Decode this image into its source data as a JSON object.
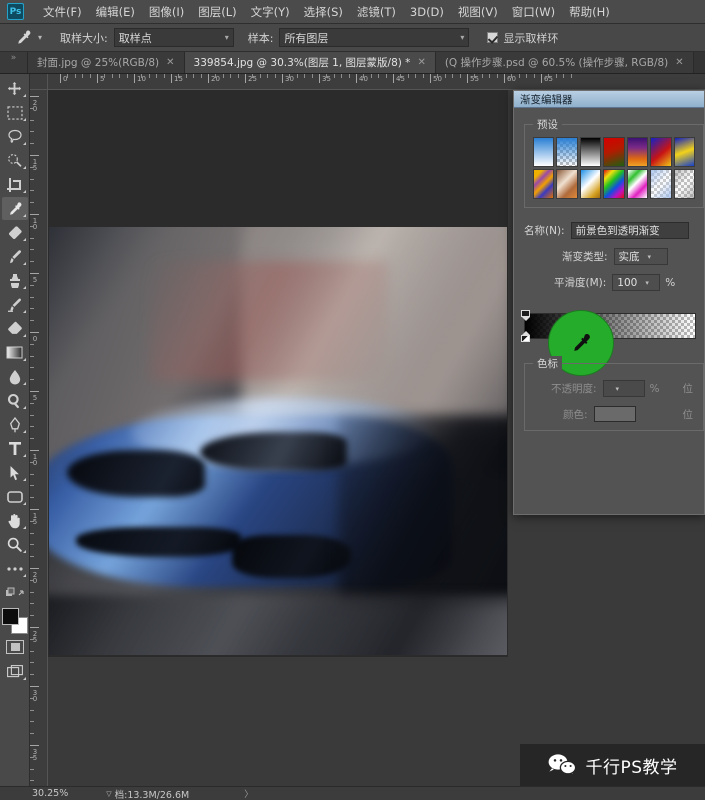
{
  "app": {
    "logo": "Ps",
    "menus": [
      {
        "label": "文件(F)"
      },
      {
        "label": "编辑(E)"
      },
      {
        "label": "图像(I)"
      },
      {
        "label": "图层(L)"
      },
      {
        "label": "文字(Y)"
      },
      {
        "label": "选择(S)"
      },
      {
        "label": "滤镜(T)"
      },
      {
        "label": "3D(D)"
      },
      {
        "label": "视图(V)"
      },
      {
        "label": "窗口(W)"
      },
      {
        "label": "帮助(H)"
      }
    ]
  },
  "options_bar": {
    "tool_icon": "eyedropper-icon",
    "sample_size_label": "取样大小:",
    "sample_size_value": "取样点",
    "sample_label": "样本:",
    "sample_value": "所有图层",
    "show_ring_label": "显示取样环",
    "show_ring_checked": true
  },
  "tabs": {
    "grip": "»",
    "items": [
      {
        "label": "封面.jpg @ 25%(RGB/8)",
        "close": "✕",
        "active": false
      },
      {
        "label": "339854.jpg @ 30.3%(图层 1, 图层蒙版/8) *",
        "close": "✕",
        "active": true
      },
      {
        "label": "(Q 操作步骤.psd @ 60.5% (操作步骤, RGB/8)",
        "close": "✕",
        "active": false
      }
    ]
  },
  "toolbar": {
    "tools": [
      {
        "name": "move-tool",
        "icon": "move-icon",
        "active": false
      },
      {
        "name": "marquee-tool",
        "icon": "rectangular-marquee-icon",
        "active": false
      },
      {
        "name": "lasso-tool",
        "icon": "lasso-icon",
        "active": false
      },
      {
        "name": "quick-selection-tool",
        "icon": "magic-wand-icon",
        "active": false
      },
      {
        "name": "crop-tool",
        "icon": "crop-icon",
        "active": false
      },
      {
        "name": "eyedropper-tool",
        "icon": "eyedropper-icon",
        "active": true
      },
      {
        "name": "healing-brush-tool",
        "icon": "spot-healing-icon",
        "active": false
      },
      {
        "name": "brush-tool",
        "icon": "brush-icon",
        "active": false
      },
      {
        "name": "clone-stamp-tool",
        "icon": "clone-stamp-icon",
        "active": false
      },
      {
        "name": "history-brush-tool",
        "icon": "history-brush-icon",
        "active": false
      },
      {
        "name": "eraser-tool",
        "icon": "eraser-icon",
        "active": false
      },
      {
        "name": "gradient-tool",
        "icon": "gradient-icon",
        "active": false
      },
      {
        "name": "blur-tool",
        "icon": "blur-drop-icon",
        "active": false
      },
      {
        "name": "dodge-tool",
        "icon": "dodge-icon",
        "active": false
      },
      {
        "name": "pen-tool",
        "icon": "pen-icon",
        "active": false
      },
      {
        "name": "type-tool",
        "icon": "type-T-icon",
        "active": false
      },
      {
        "name": "path-selection-tool",
        "icon": "path-arrow-icon",
        "active": false
      },
      {
        "name": "shape-tool",
        "icon": "rounded-rectangle-icon",
        "active": false
      },
      {
        "name": "hand-tool",
        "icon": "hand-icon",
        "active": false
      },
      {
        "name": "zoom-tool",
        "icon": "magnifier-icon",
        "active": false
      },
      {
        "name": "edit-toolbar",
        "icon": "ellipsis-icon",
        "active": false
      }
    ],
    "foreground_color": "#0d0d0d",
    "background_color": "#ffffff",
    "quick_mask_icon": "quick-mask-icon",
    "screen_mode_icon": "screen-mode-icon"
  },
  "rulers": {
    "horizontal_ticks": [
      "0",
      "5",
      "10",
      "15",
      "20",
      "25",
      "30",
      "35",
      "40",
      "45",
      "50",
      "55",
      "60",
      "65"
    ],
    "vertical_ticks": [
      "20",
      "15",
      "10",
      "5",
      "0",
      "5",
      "10",
      "15",
      "20",
      "25",
      "30",
      "35"
    ],
    "unit": "cm"
  },
  "dialog": {
    "title": "渐变编辑器",
    "presets_label": "预设",
    "presets": [
      {
        "name": "foreground-to-background",
        "css": "linear-gradient(180deg,#2a7fd4 0%, #ffffff 100%)"
      },
      {
        "name": "foreground-to-transparent",
        "css": "linear-gradient(180deg,#2a7fd4 0%, rgba(42,127,212,0) 100%)",
        "checker": true
      },
      {
        "name": "black-white",
        "css": "linear-gradient(180deg,#000000 0%, #ffffff 100%)"
      },
      {
        "name": "red-green",
        "css": "linear-gradient(160deg,#d60000 0%, #b41a00 45%, #1f5f12 100%)"
      },
      {
        "name": "violet-orange",
        "css": "linear-gradient(180deg,#3c1273 0%, #7c2a86 35%, #e06a10 75%, #f0a32a 100%)"
      },
      {
        "name": "blue-red-yellow",
        "css": "linear-gradient(140deg,#1222c8 0%, #c81414 55%, #f0c818 100%)"
      },
      {
        "name": "blue-yellow-blue",
        "css": "linear-gradient(160deg,#1020c0 0%, #f2d21a 50%, #1840c8 100%)"
      },
      {
        "name": "orange-yellow-orange",
        "css": "linear-gradient(135deg,#f0b000 18%, #9a4aa8 34%, #f0a000 52%, #3a3ac0 70%, #e07000 100%)"
      },
      {
        "name": "violet-green-orange",
        "css": "linear-gradient(135deg,#8a5a3a 0%, #f0e0d0 40%, #b06a3a 70%, #e08a3a 100%)"
      },
      {
        "name": "yellow-violet-orange-blue",
        "css": "linear-gradient(135deg,#1e90e8 0%, #ffffff 45%, #d4a020 80%, #a06a10 100%)"
      },
      {
        "name": "copper",
        "css": "linear-gradient(135deg,#e01010 0%, #f0e010 20%, #20c020 40%, #1050e0 60%, #c010c0 80%, #e01010 100%)"
      },
      {
        "name": "chrome",
        "css": "linear-gradient(135deg,#ffffff 0%, #30c030 25%, #ffffff 45%, #e020c0 70%, #ffffff 100%)",
        "checker": true
      },
      {
        "name": "spectrum",
        "css": "linear-gradient(135deg,rgba(160,190,235,.85) 0%, rgba(255,255,255,.2) 50%, rgba(160,190,235,.85) 100%)",
        "checker": true
      },
      {
        "name": "transparent-stripes",
        "css": "linear-gradient(135deg,rgba(140,140,140,.55) 0%, rgba(255,255,255,.1) 50%, rgba(140,140,140,.55) 100%)",
        "checker": true
      }
    ],
    "name_label": "名称(N):",
    "name_value": "前景色到透明渐变",
    "type_label": "渐变类型:",
    "type_value": "实底",
    "smoothness_label": "平滑度(M):",
    "smoothness_value": "100",
    "smoothness_unit": "%",
    "stops_label": "色标",
    "opacity_label": "不透明度:",
    "opacity_value": "",
    "opacity_unit": "%",
    "opacity_position_label": "位",
    "color_label": "颜色:",
    "color_value": "",
    "color_position_label": "位",
    "sampler_ring_color": "#25ac2a"
  },
  "status_bar": {
    "zoom": "30.25%",
    "doc_arrow": "▽",
    "doc_info": "档:13.3M/26.6M",
    "caret": "〉"
  },
  "watermark": {
    "icon": "wechat-icon",
    "text": "千行PS教学"
  }
}
